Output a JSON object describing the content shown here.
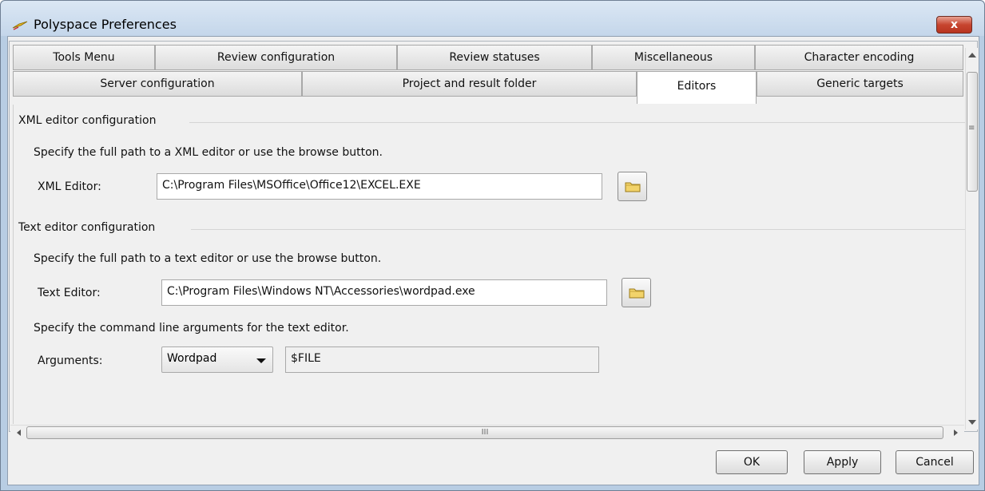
{
  "window": {
    "title": "Polyspace Preferences",
    "close_label": "x"
  },
  "tabs_row1": [
    {
      "label": "Tools Menu"
    },
    {
      "label": "Review configuration"
    },
    {
      "label": "Review statuses"
    },
    {
      "label": "Miscellaneous"
    },
    {
      "label": "Character encoding"
    }
  ],
  "tabs_row2": [
    {
      "label": "Server configuration"
    },
    {
      "label": "Project and result folder"
    },
    {
      "label": "Editors",
      "active": true
    },
    {
      "label": "Generic targets"
    }
  ],
  "xml_group": {
    "title": "XML editor configuration",
    "instruction": "Specify the full path to a XML editor or use the browse button.",
    "field_label": "XML Editor:",
    "field_value": "C:\\Program Files\\MSOffice\\Office12\\EXCEL.EXE"
  },
  "text_group": {
    "title": "Text editor configuration",
    "instruction": "Specify the full path to a text editor or use the browse button.",
    "field_label": "Text Editor:",
    "field_value": "C:\\Program Files\\Windows NT\\Accessories\\wordpad.exe",
    "args_instruction": "Specify the command line arguments for the text editor.",
    "args_label": "Arguments:",
    "args_preset": "Wordpad",
    "args_value": "$FILE"
  },
  "scroll": {
    "h_grip": "III",
    "v_grip": "≡"
  },
  "buttons": {
    "ok": "OK",
    "apply": "Apply",
    "cancel": "Cancel"
  }
}
